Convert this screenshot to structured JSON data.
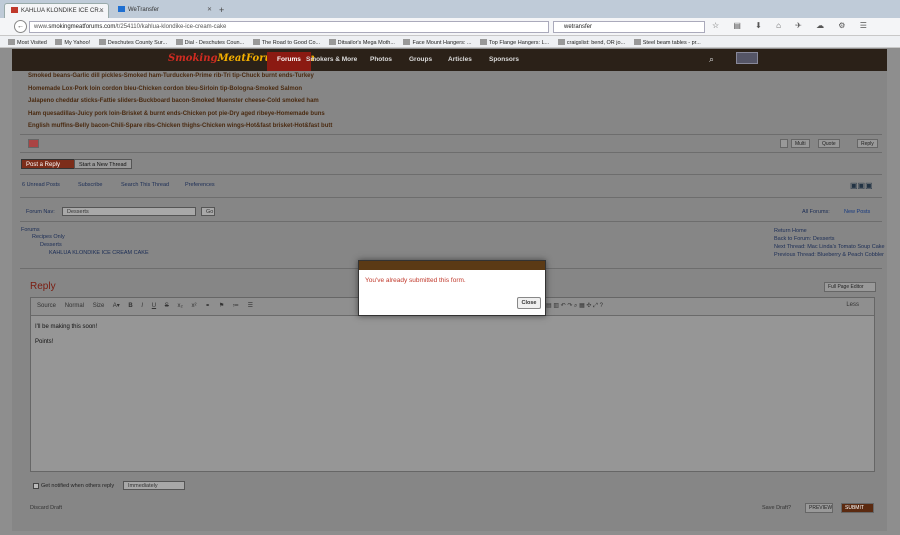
{
  "browser": {
    "tabs": [
      {
        "label": "KAHLUA KLONDIKE ICE CR..."
      },
      {
        "label": "WeTransfer"
      }
    ],
    "url_prefix": "www.",
    "url_host": "smokingmeatforums.com",
    "url_path": "/t/254110/kahlua-klondike-ice-cream-cake",
    "search_value": "wetransfer",
    "bookmarks": [
      "Most Visited",
      "My Yahoo!",
      "Deschutes County Sur...",
      "Dial - Deschutes Coun...",
      "The Road to Good Co...",
      "Ditsailor's Mega Moth...",
      "Face Mount Hangers: ...",
      "Top Flange Hangers: L...",
      "craigslist: bend, OR jo...",
      "Steel beam tables - pr..."
    ]
  },
  "site": {
    "logo_a": "Smoking",
    "logo_b": "MeatForums.com",
    "nav": [
      "Forums",
      "Smokers & More",
      "Photos",
      "Groups",
      "Articles",
      "Sponsors"
    ]
  },
  "post": {
    "lines": [
      "Smoked beans-Garlic dill pickles-Smoked ham-Turducken-Prime rib-Tri tip-Chuck burnt ends-Turkey",
      "Homemade Lox-Pork loin cordon bleu-Chicken cordon bleu-Sirloin tip-Bologna-Smoked Salmon",
      "Jalapeno cheddar sticks-Fattie sliders-Buckboard bacon-Smoked Muenster cheese-Cold smoked ham",
      "Ham quesadillas-Juicy pork loin-Brisket & burnt ends-Chicken pot pie-Dry aged ribeye-Homemade buns",
      "English muffins-Belly bacon-Chili-Spare ribs-Chicken thighs-Chicken wings-Hot&fast brisket-Hot&fast butt"
    ],
    "actions": [
      "Multi",
      "Quote",
      "Reply"
    ]
  },
  "thread": {
    "post_reply": "Post a Reply",
    "start_thread": "Start a New Thread",
    "unread": "6 Unread Posts",
    "subscribe": "Subscribe",
    "search_thread": "Search This Thread",
    "preferences": "Preferences",
    "forum_nav_label": "Forum Nav:",
    "forum_nav_value": "Desserts",
    "go": "Go",
    "all_forums": "All Forums:",
    "new_posts": "New Posts",
    "crumbs": [
      "Forums",
      "Recipes Only",
      "Desserts",
      "KAHLUA KLONDIKE ICE CREAM CAKE"
    ],
    "links": [
      "Return Home",
      "Back to Forum: Desserts",
      "Next Thread: Mac Linda's Tomato Soup Cake",
      "Previous Thread: Blueberry & Peach Cobbler"
    ]
  },
  "reply": {
    "heading": "Reply",
    "full_page_editor": "Full Page Editor",
    "toolbar_source": "Source",
    "toolbar_normal": "Normal",
    "toolbar_size": "Size",
    "toolbar_less": "Less",
    "body_lines": [
      "I'll be making this soon!",
      "Points!"
    ],
    "notify_label": "Get notified when others reply",
    "notify_value": "Immediately",
    "discard": "Discard Draft",
    "save_draft": "Save Draft?",
    "preview": "PREVIEW",
    "submit": "SUBMIT"
  },
  "modal": {
    "message": "You've already submitted this form.",
    "close": "Close"
  },
  "colors": {
    "brand_red": "#8b1a12",
    "nav_bg": "#2b2118",
    "error_text": "#c0392b"
  }
}
